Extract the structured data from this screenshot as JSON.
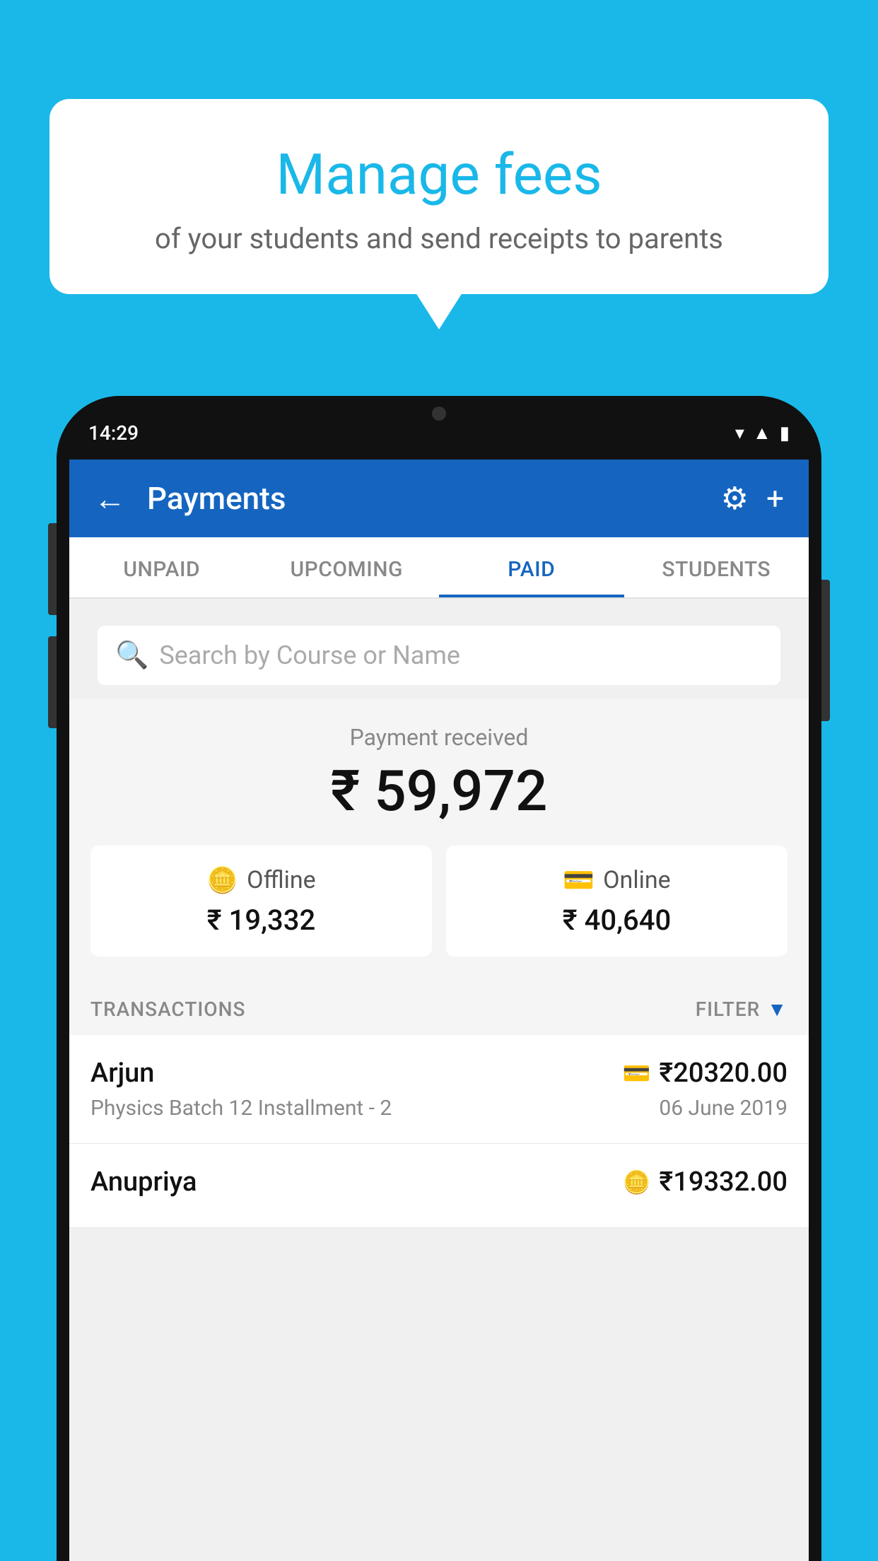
{
  "background": {
    "color": "#1ab8e8"
  },
  "speech_bubble": {
    "title": "Manage fees",
    "subtitle": "of your students and send receipts to parents"
  },
  "phone": {
    "status_bar": {
      "time": "14:29"
    },
    "top_bar": {
      "title": "Payments",
      "back_label": "←",
      "gear_label": "⚙",
      "plus_label": "+"
    },
    "tabs": [
      {
        "label": "UNPAID",
        "active": false
      },
      {
        "label": "UPCOMING",
        "active": false
      },
      {
        "label": "PAID",
        "active": true
      },
      {
        "label": "STUDENTS",
        "active": false
      }
    ],
    "search": {
      "placeholder": "Search by Course or Name"
    },
    "payment_summary": {
      "label": "Payment received",
      "amount": "₹ 59,972",
      "offline": {
        "label": "Offline",
        "amount": "₹ 19,332"
      },
      "online": {
        "label": "Online",
        "amount": "₹ 40,640"
      }
    },
    "transactions": {
      "label": "TRANSACTIONS",
      "filter_label": "FILTER",
      "rows": [
        {
          "name": "Arjun",
          "course": "Physics Batch 12 Installment - 2",
          "amount": "₹20320.00",
          "date": "06 June 2019",
          "type": "online"
        },
        {
          "name": "Anupriya",
          "course": "",
          "amount": "₹19332.00",
          "date": "",
          "type": "offline"
        }
      ]
    }
  }
}
